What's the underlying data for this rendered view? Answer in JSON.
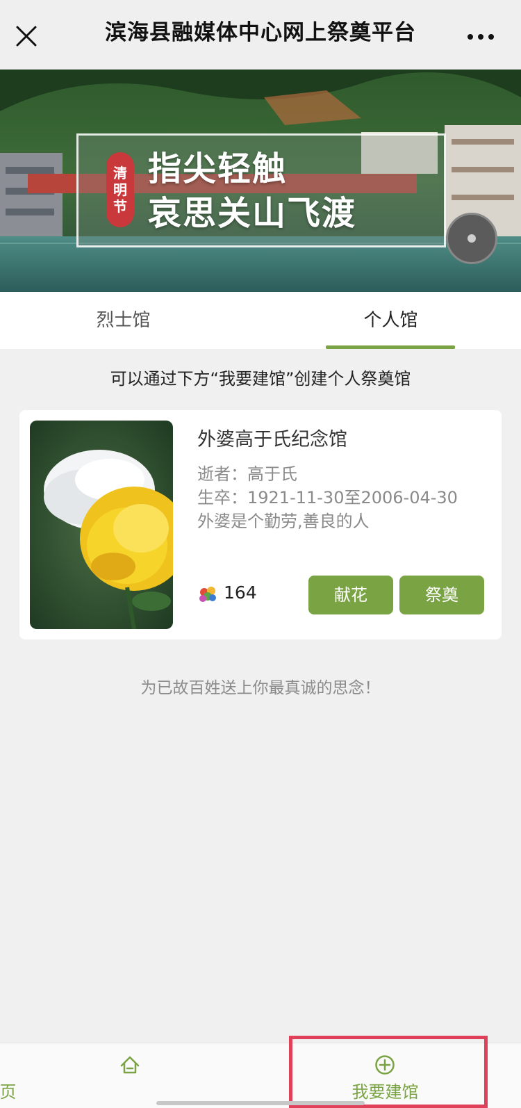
{
  "topbar": {
    "title": "滨海县融媒体中心网上祭奠平台",
    "close_icon": "close-icon",
    "more_icon": "more-icon"
  },
  "banner": {
    "badge": [
      "清",
      "明",
      "节"
    ],
    "line1": "指尖轻触",
    "line2": "哀思关山飞渡",
    "music_icon": "music-disc-icon"
  },
  "tabs": [
    {
      "label": "烈士馆",
      "active": false
    },
    {
      "label": "个人馆",
      "active": true
    }
  ],
  "hint": "可以通过下方“我要建馆”创建个人祭奠馆",
  "memorial": {
    "name": "外婆高于氏纪念馆",
    "deceased": "逝者：高于氏",
    "lifespan": "生卒：1921-11-30至2006-04-30",
    "description": "外婆是个勤劳,善良的人",
    "flower_count": "164",
    "offer_flower_button": "献花",
    "pay_tribute_button": "祭奠"
  },
  "footer_slogan": "为已故百姓送上你最真诚的思念！",
  "bottom_nav": [
    {
      "label": "首页",
      "icon": "home-icon"
    },
    {
      "label": "我要建馆",
      "icon": "plus-circle-icon"
    }
  ],
  "colors": {
    "accent": "#7aa344",
    "highlight": "#e0405a",
    "badge": "#c9383a"
  }
}
